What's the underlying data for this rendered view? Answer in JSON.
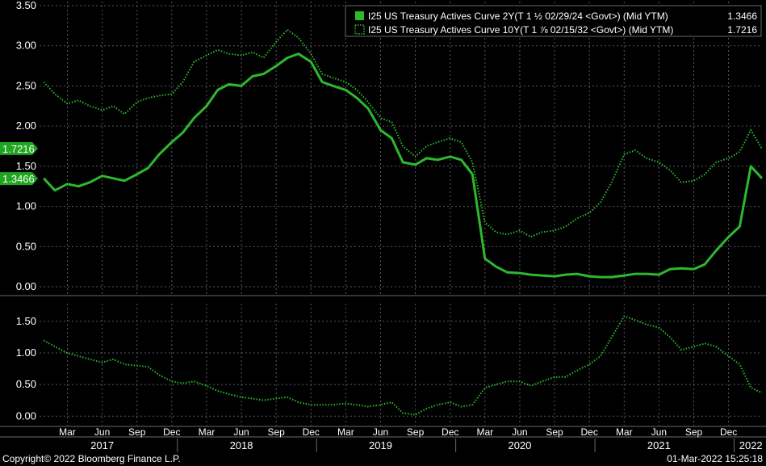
{
  "legend": [
    {
      "label": "I25 US Treasury Actives Curve 2Y(T 1 ½ 02/29/24 <Govt>) (Mid YTM)",
      "value": "1.3466",
      "style": "solid"
    },
    {
      "label": "I25 US Treasury Actives Curve 10Y(T 1 ⅞ 02/15/32 <Govt>) (Mid YTM)",
      "value": "1.7216",
      "style": "dotted"
    }
  ],
  "footer": {
    "copyright": "Copyright© 2022 Bloomberg Finance L.P.",
    "timestamp": "01-Mar-2022 15:25:18"
  },
  "colors": {
    "background": "#000000",
    "series": "#2db82d",
    "grid": "#5a5a5a",
    "label_bg": "#1fa51f"
  },
  "chart_data": [
    {
      "type": "line",
      "panel": "upper",
      "ylim": [
        -0.1,
        3.55
      ],
      "yticks": [
        "0.00",
        "0.50",
        "1.00",
        "1.50",
        "2.00",
        "2.50",
        "3.00",
        "3.50"
      ],
      "grid": true,
      "legend_position": "top-right",
      "last_value_labels": [
        "1.7216",
        "1.3466"
      ],
      "series": [
        {
          "name": "I25 US Treasury Actives Curve 2Y(T 1 ½ 02/29/24 <Govt>) (Mid YTM)",
          "style": "solid",
          "x": [
            2017.0,
            2017.08,
            2017.17,
            2017.25,
            2017.33,
            2017.42,
            2017.5,
            2017.58,
            2017.67,
            2017.75,
            2017.83,
            2017.92,
            2018.0,
            2018.08,
            2018.17,
            2018.25,
            2018.33,
            2018.42,
            2018.5,
            2018.58,
            2018.67,
            2018.75,
            2018.83,
            2018.92,
            2019.0,
            2019.08,
            2019.17,
            2019.25,
            2019.33,
            2019.42,
            2019.5,
            2019.58,
            2019.67,
            2019.75,
            2019.83,
            2019.92,
            2020.0,
            2020.08,
            2020.17,
            2020.25,
            2020.33,
            2020.42,
            2020.5,
            2020.58,
            2020.67,
            2020.75,
            2020.83,
            2020.92,
            2021.0,
            2021.08,
            2021.17,
            2021.25,
            2021.33,
            2021.42,
            2021.5,
            2021.58,
            2021.67,
            2021.75,
            2021.83,
            2021.92,
            2022.0,
            2022.08,
            2022.16
          ],
          "y": [
            1.35,
            1.2,
            1.28,
            1.25,
            1.3,
            1.38,
            1.35,
            1.32,
            1.4,
            1.48,
            1.65,
            1.8,
            1.92,
            2.1,
            2.25,
            2.45,
            2.52,
            2.5,
            2.62,
            2.65,
            2.75,
            2.85,
            2.9,
            2.8,
            2.55,
            2.5,
            2.45,
            2.35,
            2.22,
            1.95,
            1.85,
            1.55,
            1.52,
            1.6,
            1.58,
            1.62,
            1.58,
            1.4,
            0.35,
            0.25,
            0.18,
            0.17,
            0.15,
            0.14,
            0.13,
            0.15,
            0.16,
            0.13,
            0.12,
            0.12,
            0.14,
            0.16,
            0.16,
            0.15,
            0.22,
            0.23,
            0.22,
            0.28,
            0.45,
            0.62,
            0.75,
            1.5,
            1.35
          ]
        },
        {
          "name": "I25 US Treasury Actives Curve 10Y(T 1 ⅞ 02/15/32 <Govt>) (Mid YTM)",
          "style": "dotted",
          "x": [
            2017.0,
            2017.08,
            2017.17,
            2017.25,
            2017.33,
            2017.42,
            2017.5,
            2017.58,
            2017.67,
            2017.75,
            2017.83,
            2017.92,
            2018.0,
            2018.08,
            2018.17,
            2018.25,
            2018.33,
            2018.42,
            2018.5,
            2018.58,
            2018.67,
            2018.75,
            2018.83,
            2018.92,
            2019.0,
            2019.08,
            2019.17,
            2019.25,
            2019.33,
            2019.42,
            2019.5,
            2019.58,
            2019.67,
            2019.75,
            2019.83,
            2019.92,
            2020.0,
            2020.08,
            2020.17,
            2020.25,
            2020.33,
            2020.42,
            2020.5,
            2020.58,
            2020.67,
            2020.75,
            2020.83,
            2020.92,
            2021.0,
            2021.08,
            2021.17,
            2021.25,
            2021.33,
            2021.42,
            2021.5,
            2021.58,
            2021.67,
            2021.75,
            2021.83,
            2021.92,
            2022.0,
            2022.08,
            2022.16
          ],
          "y": [
            2.55,
            2.4,
            2.28,
            2.32,
            2.25,
            2.2,
            2.25,
            2.15,
            2.3,
            2.35,
            2.38,
            2.4,
            2.55,
            2.8,
            2.88,
            2.95,
            2.9,
            2.88,
            2.92,
            2.85,
            3.05,
            3.2,
            3.1,
            2.9,
            2.65,
            2.6,
            2.55,
            2.45,
            2.3,
            2.1,
            2.05,
            1.75,
            1.62,
            1.75,
            1.8,
            1.85,
            1.8,
            1.55,
            0.8,
            0.68,
            0.65,
            0.7,
            0.62,
            0.68,
            0.7,
            0.75,
            0.85,
            0.92,
            1.05,
            1.3,
            1.65,
            1.7,
            1.6,
            1.55,
            1.45,
            1.3,
            1.32,
            1.4,
            1.55,
            1.6,
            1.68,
            1.95,
            1.72
          ]
        }
      ]
    },
    {
      "type": "line",
      "panel": "lower",
      "ylim": [
        -0.15,
        1.78
      ],
      "yticks": [
        "0.00",
        "0.50",
        "1.00",
        "1.50"
      ],
      "grid": true,
      "series": [
        {
          "name": "",
          "style": "dotted",
          "x": [
            2017.0,
            2017.08,
            2017.17,
            2017.25,
            2017.33,
            2017.42,
            2017.5,
            2017.58,
            2017.67,
            2017.75,
            2017.83,
            2017.92,
            2018.0,
            2018.08,
            2018.17,
            2018.25,
            2018.33,
            2018.42,
            2018.5,
            2018.58,
            2018.67,
            2018.75,
            2018.83,
            2018.92,
            2019.0,
            2019.08,
            2019.17,
            2019.25,
            2019.33,
            2019.42,
            2019.5,
            2019.58,
            2019.67,
            2019.75,
            2019.83,
            2019.92,
            2020.0,
            2020.08,
            2020.17,
            2020.25,
            2020.33,
            2020.42,
            2020.5,
            2020.58,
            2020.67,
            2020.75,
            2020.83,
            2020.92,
            2021.0,
            2021.08,
            2021.17,
            2021.25,
            2021.33,
            2021.42,
            2021.5,
            2021.58,
            2021.67,
            2021.75,
            2021.83,
            2021.92,
            2022.0,
            2022.08,
            2022.16
          ],
          "y": [
            1.2,
            1.1,
            1.0,
            0.95,
            0.9,
            0.85,
            0.9,
            0.82,
            0.8,
            0.78,
            0.65,
            0.55,
            0.52,
            0.55,
            0.48,
            0.4,
            0.35,
            0.3,
            0.28,
            0.25,
            0.28,
            0.3,
            0.22,
            0.18,
            0.18,
            0.18,
            0.2,
            0.18,
            0.15,
            0.18,
            0.22,
            0.05,
            0.02,
            0.12,
            0.18,
            0.22,
            0.15,
            0.18,
            0.45,
            0.5,
            0.55,
            0.55,
            0.48,
            0.55,
            0.62,
            0.62,
            0.72,
            0.82,
            0.95,
            1.25,
            1.58,
            1.52,
            1.45,
            1.4,
            1.25,
            1.05,
            1.1,
            1.15,
            1.1,
            0.95,
            0.82,
            0.45,
            0.37
          ]
        }
      ]
    }
  ],
  "x_axis": {
    "range": [
      2016.97,
      2022.16
    ],
    "month_labels": [
      "Mar",
      "Jun",
      "Sep",
      "Dec",
      "Mar",
      "Jun",
      "Sep",
      "Dec",
      "Mar",
      "Jun",
      "Sep",
      "Dec",
      "Mar",
      "Jun",
      "Sep",
      "Dec",
      "Mar",
      "Jun",
      "Sep",
      "Dec"
    ],
    "month_positions": [
      2017.17,
      2017.42,
      2017.67,
      2017.92,
      2018.17,
      2018.42,
      2018.67,
      2018.92,
      2019.17,
      2019.42,
      2019.67,
      2019.92,
      2020.17,
      2020.42,
      2020.67,
      2020.92,
      2021.17,
      2021.42,
      2021.67,
      2021.92
    ],
    "year_labels": [
      "2017",
      "2018",
      "2019",
      "2020",
      "2021",
      "2022"
    ],
    "year_positions": [
      2017.42,
      2018.42,
      2019.42,
      2020.42,
      2021.42,
      2022.08
    ]
  }
}
